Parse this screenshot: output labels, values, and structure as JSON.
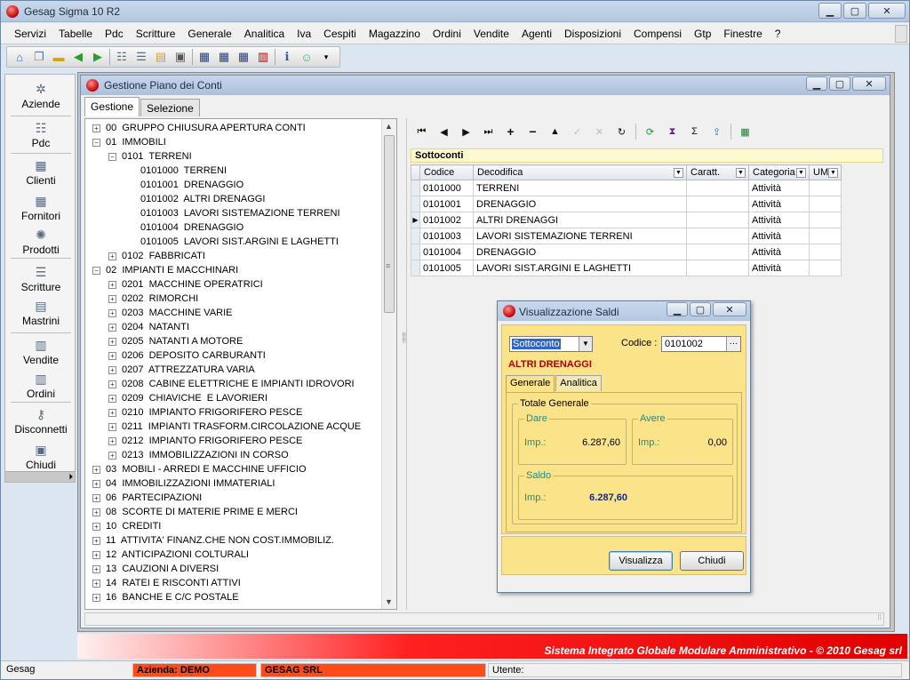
{
  "app": {
    "title": "Gesag Sigma 10 R2"
  },
  "menu": [
    "Servizi",
    "Tabelle",
    "Pdc",
    "Scritture",
    "Generale",
    "Analitica",
    "Iva",
    "Cespiti",
    "Magazzino",
    "Ordini",
    "Vendite",
    "Agenti",
    "Disposizioni",
    "Compensi",
    "Gtp",
    "Finestre",
    "?"
  ],
  "sidebar": [
    {
      "label": "Aziende",
      "icon": "company-icon"
    },
    {
      "label": "Pdc",
      "icon": "chart-of-accounts-icon"
    },
    {
      "label": "Clienti",
      "icon": "clients-icon"
    },
    {
      "label": "Fornitori",
      "icon": "suppliers-icon"
    },
    {
      "label": "Prodotti",
      "icon": "products-icon"
    },
    {
      "label": "Scritture",
      "icon": "journal-icon"
    },
    {
      "label": "Mastrini",
      "icon": "ledger-icon"
    },
    {
      "label": "Vendite",
      "icon": "sales-icon"
    },
    {
      "label": "Ordini",
      "icon": "orders-icon"
    },
    {
      "label": "Disconnetti",
      "icon": "disconnect-icon"
    },
    {
      "label": "Chiudi",
      "icon": "close-app-icon"
    }
  ],
  "child": {
    "title": "Gestione Piano dei Conti",
    "tabs": [
      "Gestione",
      "Selezione"
    ],
    "tree": [
      {
        "text": "00  GRUPPO CHIUSURA APERTURA CONTI",
        "level": 0,
        "exp": "+"
      },
      {
        "text": "01  IMMOBILI",
        "level": 0,
        "exp": "-"
      },
      {
        "text": "0101  TERRENI",
        "level": 1,
        "exp": "-"
      },
      {
        "text": "0101000  TERRENI",
        "level": 2,
        "exp": ""
      },
      {
        "text": "0101001  DRENAGGIO",
        "level": 2,
        "exp": ""
      },
      {
        "text": "0101002  ALTRI DRENAGGI",
        "level": 2,
        "exp": ""
      },
      {
        "text": "0101003  LAVORI SISTEMAZIONE TERRENI",
        "level": 2,
        "exp": ""
      },
      {
        "text": "0101004  DRENAGGIO",
        "level": 2,
        "exp": ""
      },
      {
        "text": "0101005  LAVORI SIST.ARGINI E LAGHETTI",
        "level": 2,
        "exp": ""
      },
      {
        "text": "0102  FABBRICATI",
        "level": 1,
        "exp": "+"
      },
      {
        "text": "02  IMPIANTI E MACCHINARI",
        "level": 0,
        "exp": "-"
      },
      {
        "text": "0201  MACCHINE OPERATRICI",
        "level": 1,
        "exp": "+"
      },
      {
        "text": "0202  RIMORCHI",
        "level": 1,
        "exp": "+"
      },
      {
        "text": "0203  MACCHINE VARIE",
        "level": 1,
        "exp": "+"
      },
      {
        "text": "0204  NATANTI",
        "level": 1,
        "exp": "+"
      },
      {
        "text": "0205  NATANTI A MOTORE",
        "level": 1,
        "exp": "+"
      },
      {
        "text": "0206  DEPOSITO CARBURANTI",
        "level": 1,
        "exp": "+"
      },
      {
        "text": "0207  ATTREZZATURA VARIA",
        "level": 1,
        "exp": "+"
      },
      {
        "text": "0208  CABINE ELETTRICHE E IMPIANTI IDROVORI",
        "level": 1,
        "exp": "+"
      },
      {
        "text": "0209  CHIAVICHE  E LAVORIERI",
        "level": 1,
        "exp": "+"
      },
      {
        "text": "0210  IMPIANTO FRIGORIFERO PESCE",
        "level": 1,
        "exp": "+"
      },
      {
        "text": "0211  IMPIANTI TRASFORM.CIRCOLAZIONE ACQUE",
        "level": 1,
        "exp": "+"
      },
      {
        "text": "0212  IMPIANTO FRIGORIFERO PESCE",
        "level": 1,
        "exp": "+"
      },
      {
        "text": "0213  IMMOBILIZZAZIONI IN CORSO",
        "level": 1,
        "exp": "+"
      },
      {
        "text": "03  MOBILI - ARREDI E MACCHINE UFFICIO",
        "level": 0,
        "exp": "+"
      },
      {
        "text": "04  IMMOBILIZZAZIONI IMMATERIALI",
        "level": 0,
        "exp": "+"
      },
      {
        "text": "06  PARTECIPAZIONI",
        "level": 0,
        "exp": "+"
      },
      {
        "text": "08  SCORTE DI MATERIE PRIME E MERCI",
        "level": 0,
        "exp": "+"
      },
      {
        "text": "10  CREDITI",
        "level": 0,
        "exp": "+"
      },
      {
        "text": "11  ATTIVITA' FINANZ.CHE NON COST.IMMOBILIZ.",
        "level": 0,
        "exp": "+"
      },
      {
        "text": "12  ANTICIPAZIONI COLTURALI",
        "level": 0,
        "exp": "+"
      },
      {
        "text": "13  CAUZIONI A DIVERSI",
        "level": 0,
        "exp": "+"
      },
      {
        "text": "14  RATEI E RISCONTI ATTIVI",
        "level": 0,
        "exp": "+"
      },
      {
        "text": "16  BANCHE E C/C POSTALE",
        "level": 0,
        "exp": "+"
      }
    ],
    "sottoconti_label": "Sottoconti",
    "grid": {
      "columns": [
        "Codice",
        "Decodifica",
        "Caratt.",
        "Categoria",
        "UM"
      ],
      "rows": [
        [
          "0101000",
          "TERRENI",
          "",
          "Attività",
          ""
        ],
        [
          "0101001",
          "DRENAGGIO",
          "",
          "Attività",
          ""
        ],
        [
          "0101002",
          "ALTRI DRENAGGI",
          "",
          "Attività",
          ""
        ],
        [
          "0101003",
          "LAVORI SISTEMAZIONE TERRENI",
          "",
          "Attività",
          ""
        ],
        [
          "0101004",
          "DRENAGGIO",
          "",
          "Attività",
          ""
        ],
        [
          "0101005",
          "LAVORI SIST.ARGINI E LAGHETTI",
          "",
          "Attività",
          ""
        ]
      ],
      "current_row": 2
    }
  },
  "dialog": {
    "title": "Visualizzazione Saldi",
    "type_value": "Sottoconto",
    "code_label": "Codice :",
    "code_value": "0101002",
    "account_name": "ALTRI DRENAGGI",
    "tabs": [
      "Generale",
      "Analitica"
    ],
    "group_title": "Totale Generale",
    "dare": {
      "title": "Dare",
      "label": "Imp.:",
      "value": "6.287,60"
    },
    "avere": {
      "title": "Avere",
      "label": "Imp.:",
      "value": "0,00"
    },
    "saldo": {
      "title": "Saldo",
      "label": "Imp.:",
      "value": "6.287,60"
    },
    "btn_view": "Visualizza",
    "btn_close": "Chiudi"
  },
  "footer_text": "Sistema Integrato Globale Modulare Amministrativo - © 2010 Gesag srl",
  "status": {
    "app": "Gesag",
    "azienda": "Azienda: DEMO",
    "company": "GESAG SRL",
    "utente": "Utente:"
  },
  "colors": {
    "accent_red": "#e00000",
    "dialog_bg": "#fbe389",
    "status_red": "#ff4a1a",
    "teal": "#1f8a8a"
  }
}
